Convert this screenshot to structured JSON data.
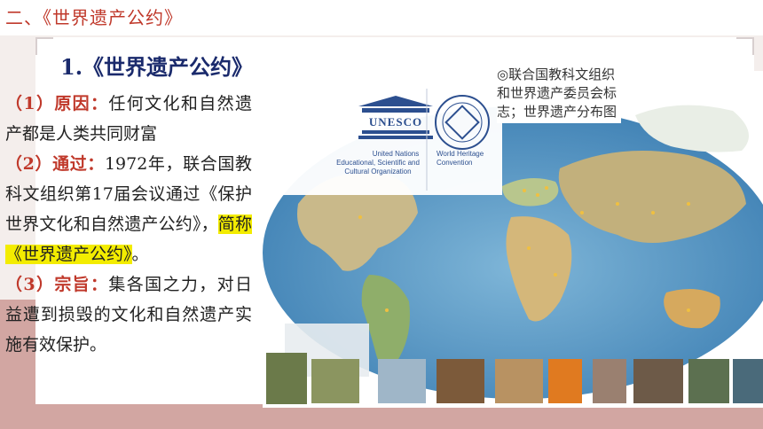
{
  "header": {
    "title": "二、《世界遗产公约》"
  },
  "section": {
    "title": "1.《世界遗产公约》"
  },
  "points": [
    {
      "label": "（1）原因：",
      "text": "任何文化和自然遗产都是人类共同财富"
    },
    {
      "label": "（2）通过：",
      "text": "1972年，联合国教科文组织第17届会议通过《保护世界文化和自然遗产公约》，",
      "highlight": "简称《世界遗产公约》",
      "tail": "。"
    },
    {
      "label": "（3）宗旨：",
      "text": "集各国之力，对日益遭到损毁的文化和自然遗产实施有效保护。"
    }
  ],
  "caption": "◎联合国教科文组织和世界遗产委员会标志；世界遗产分布图",
  "logos": {
    "unesco_word": "UNESCO",
    "unesco_text": [
      "United Nations",
      "Educational, Scientific and",
      "Cultural Organization"
    ],
    "whc_text": [
      "World Heritage",
      "Convention"
    ]
  },
  "colors": {
    "accent_red": "#c0392b",
    "title_blue": "#1a2a6c",
    "highlight": "#f3ec00",
    "band": "#d2a6a2"
  }
}
